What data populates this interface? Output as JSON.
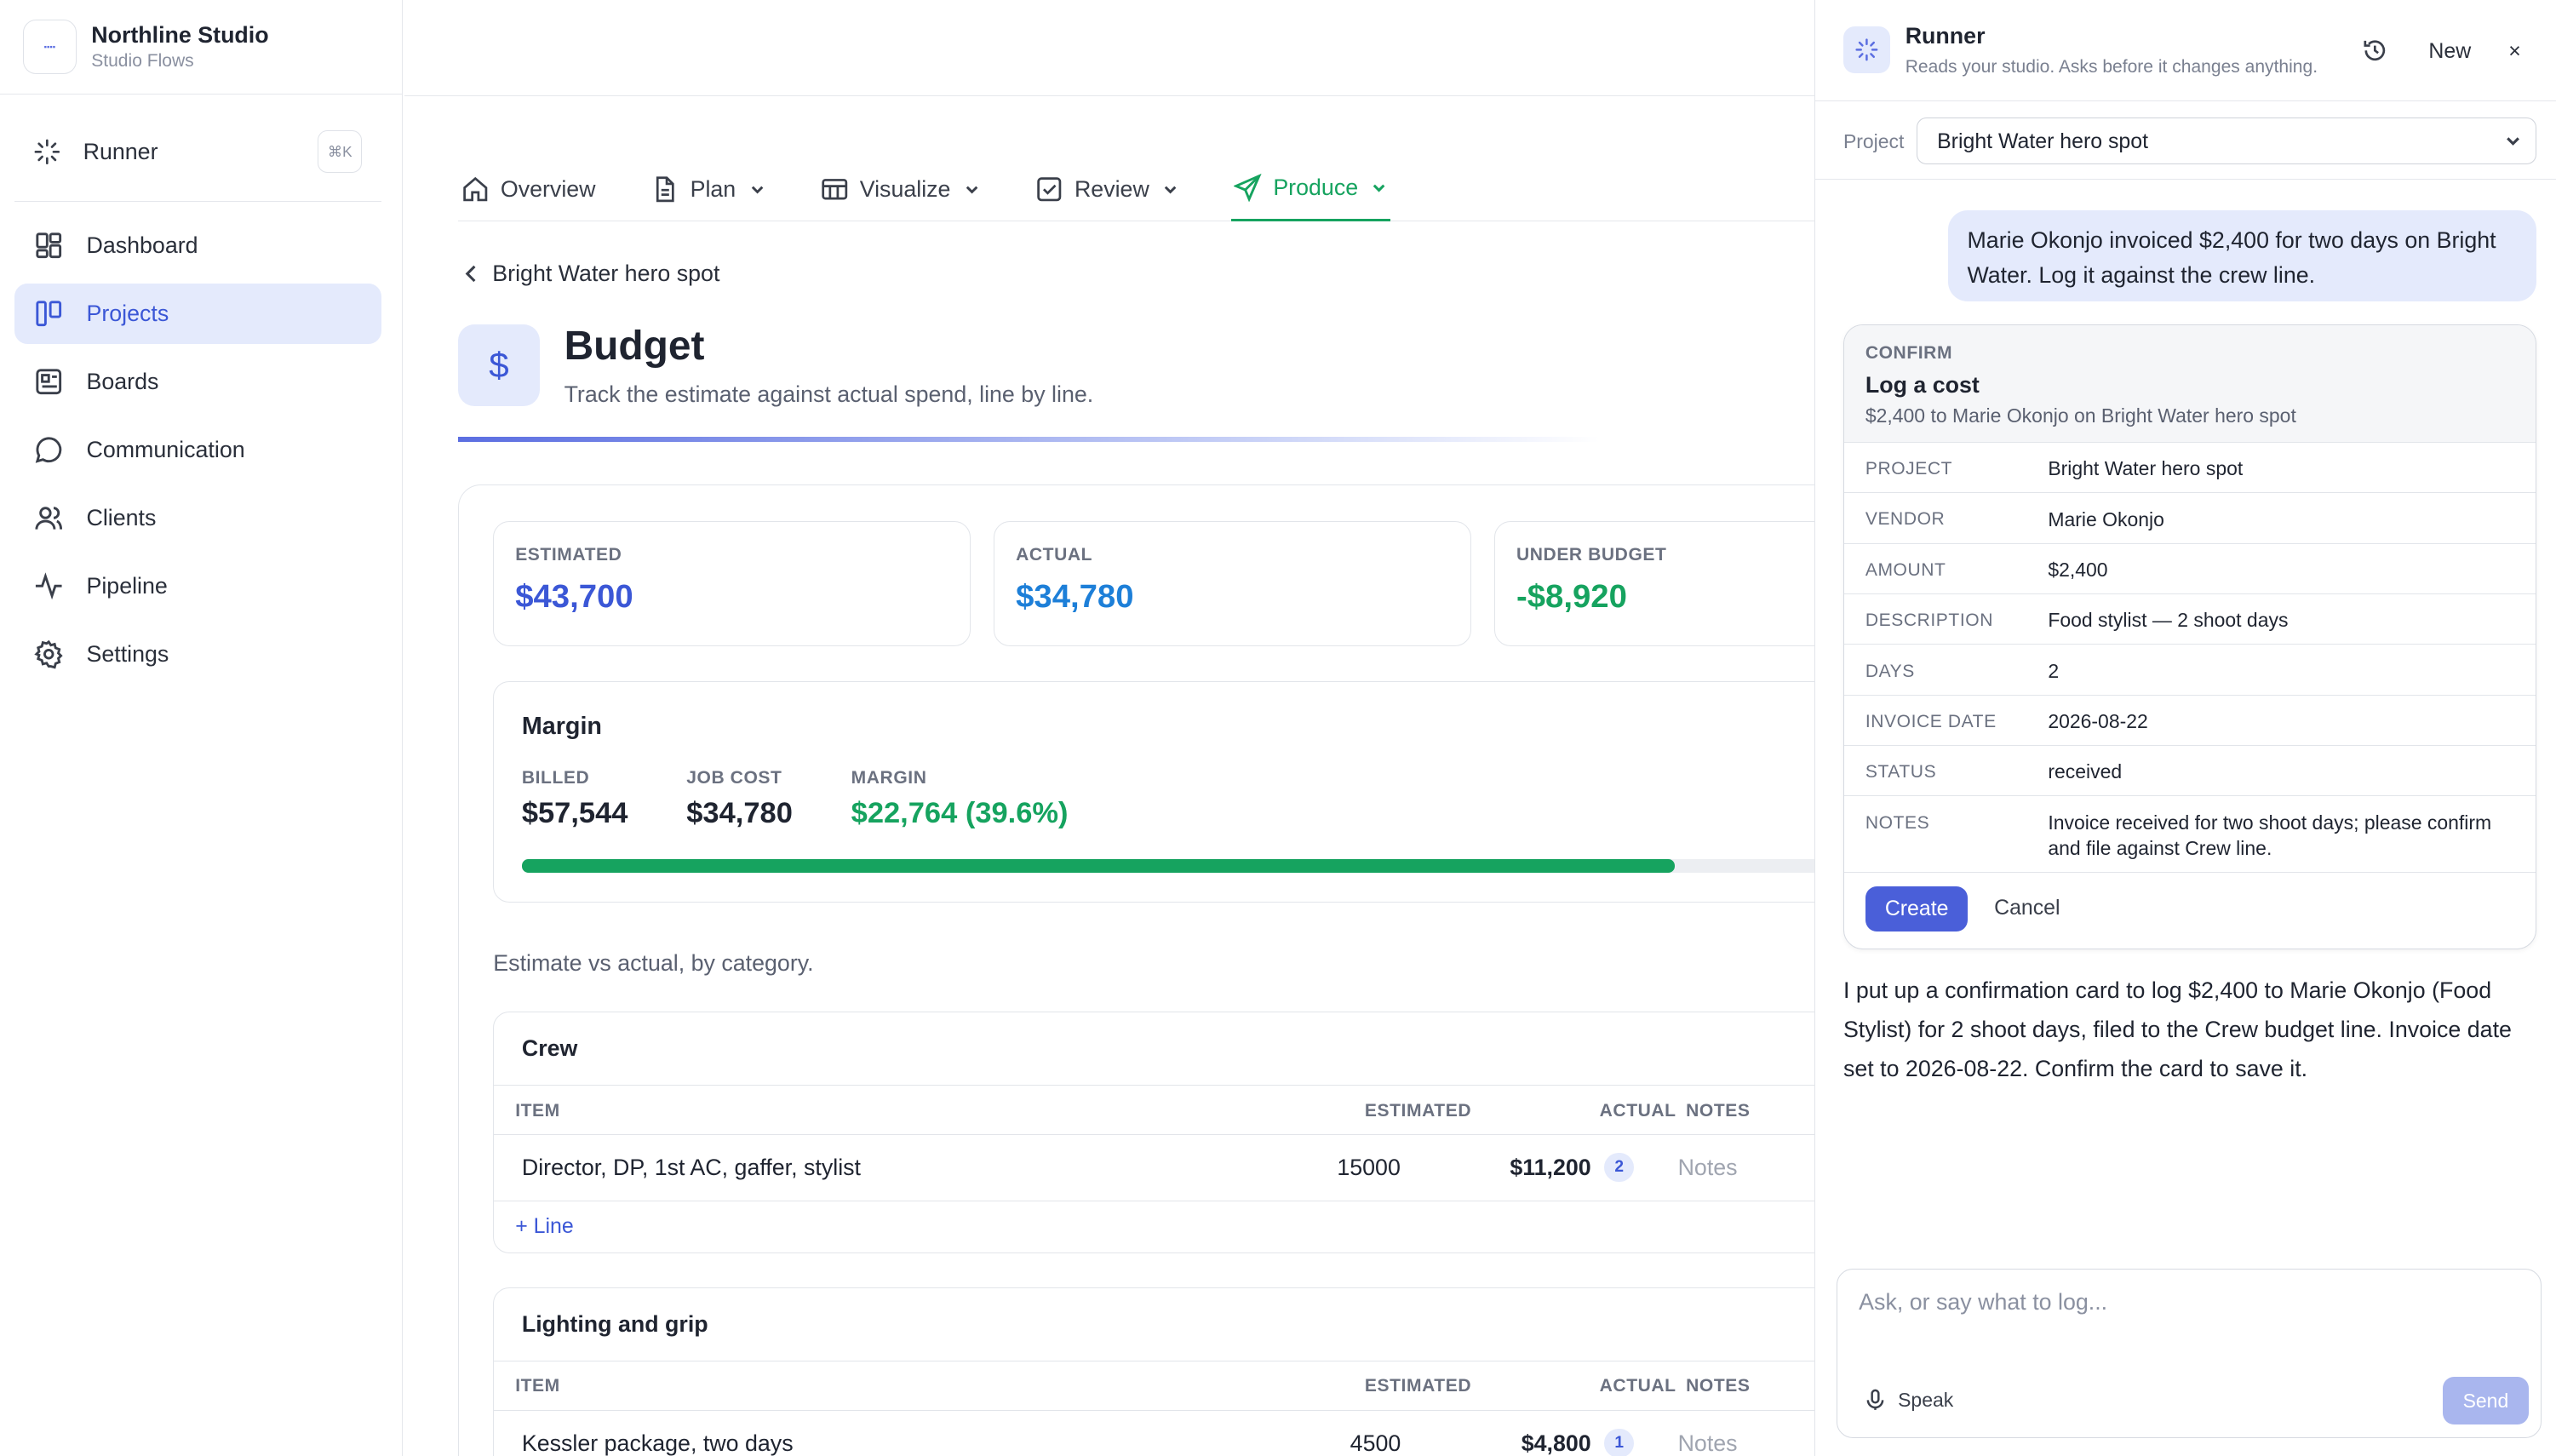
{
  "brand": {
    "name": "Northline Studio",
    "subtitle": "Studio Flows"
  },
  "sidebar": {
    "runner": {
      "label": "Runner",
      "shortcut": "⌘K"
    },
    "items": [
      {
        "label": "Dashboard",
        "icon": "dashboard-icon"
      },
      {
        "label": "Projects",
        "icon": "projects-icon",
        "active": true
      },
      {
        "label": "Boards",
        "icon": "boards-icon"
      },
      {
        "label": "Communication",
        "icon": "chat-icon"
      },
      {
        "label": "Clients",
        "icon": "clients-icon"
      },
      {
        "label": "Pipeline",
        "icon": "pipeline-icon"
      },
      {
        "label": "Settings",
        "icon": "gear-icon"
      }
    ]
  },
  "tabs": [
    {
      "label": "Overview"
    },
    {
      "label": "Plan"
    },
    {
      "label": "Visualize"
    },
    {
      "label": "Review"
    },
    {
      "label": "Produce",
      "active": true
    }
  ],
  "page": {
    "back_label": "Bright Water hero spot",
    "title": "Budget",
    "subtitle": "Track the estimate against actual spend, line by line."
  },
  "stats": [
    {
      "label": "ESTIMATED",
      "value": "$43,700",
      "color": "#3b57d6"
    },
    {
      "label": "ACTUAL",
      "value": "$34,780",
      "color": "#1d7fd8"
    },
    {
      "label": "UNDER BUDGET",
      "value": "-$8,920",
      "color": "#16a35f"
    }
  ],
  "margin": {
    "title": "Margin",
    "billed_label": "BILLED",
    "billed": "$57,544",
    "job_cost_label": "JOB COST",
    "job_cost": "$34,780",
    "margin_label": "MARGIN",
    "margin": "$22,764 (39.6%)",
    "bar_fraction": 0.822
  },
  "category_note": "Estimate vs actual, by category.",
  "table_headers": {
    "item": "ITEM",
    "estimated": "ESTIMATED",
    "actual": "ACTUAL",
    "notes": "NOTES"
  },
  "categories": [
    {
      "title": "Crew",
      "rows": [
        {
          "item": "Director, DP, 1st AC, gaffer, stylist",
          "estimated": "15000",
          "actual": "$11,200",
          "count": "2",
          "notes": "Notes"
        }
      ],
      "add_label": "+ Line"
    },
    {
      "title": "Lighting and grip",
      "rows": [
        {
          "item": "Kessler package, two days",
          "estimated": "4500",
          "actual": "$4,800",
          "count": "1",
          "notes": "Notes"
        }
      ]
    }
  ],
  "panel": {
    "title": "Runner",
    "subtitle": "Reads your studio. Asks before it changes anything.",
    "new_label": "New",
    "close_label": "×",
    "project_label": "Project",
    "project_value": "Bright Water hero spot",
    "user_message": "Marie Okonjo invoiced $2,400 for two days on Bright Water. Log it against the crew line.",
    "confirm": {
      "kicker": "CONFIRM",
      "title": "Log a cost",
      "summary": "$2,400 to Marie Okonjo on Bright Water hero spot",
      "rows": [
        {
          "k": "PROJECT",
          "v": "Bright Water hero spot"
        },
        {
          "k": "VENDOR",
          "v": "Marie Okonjo"
        },
        {
          "k": "AMOUNT",
          "v": "$2,400"
        },
        {
          "k": "DESCRIPTION",
          "v": "Food stylist — 2 shoot days"
        },
        {
          "k": "DAYS",
          "v": "2"
        },
        {
          "k": "INVOICE DATE",
          "v": "2026-08-22"
        },
        {
          "k": "STATUS",
          "v": "received"
        },
        {
          "k": "NOTES",
          "v": "Invoice received for two shoot days; please confirm and file against Crew line."
        }
      ],
      "create_label": "Create",
      "cancel_label": "Cancel"
    },
    "reply": "I put up a confirmation card to log $2,400 to Marie Okonjo (Food Stylist) for 2 shoot days, filed to the Crew budget line. Invoice date set to 2026-08-22. Confirm the card to save it.",
    "composer_placeholder": "Ask, or say what to log...",
    "speak_label": "Speak",
    "send_label": "Send"
  }
}
